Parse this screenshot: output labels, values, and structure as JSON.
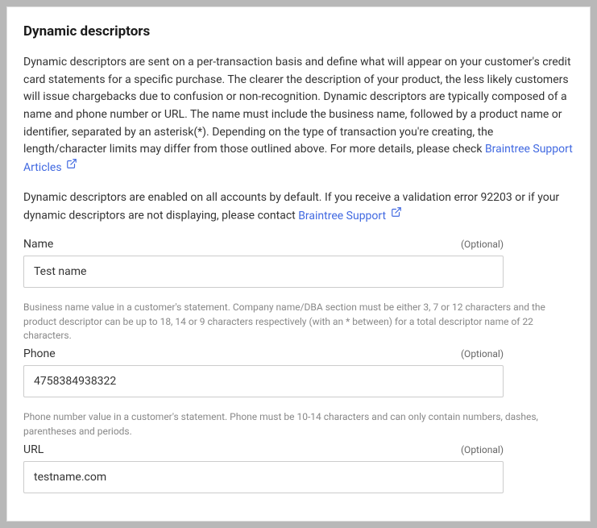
{
  "section": {
    "title": "Dynamic descriptors",
    "intro_text": "Dynamic descriptors are sent on a per-transaction basis and define what will appear on your customer's credit card statements for a specific purchase. The clearer the description of your product, the less likely customers will issue chargebacks due to confusion or non-recognition. Dynamic descriptors are typically composed of a name and phone number or URL. The name must include the business name, followed by a product name or identifier, separated by an asterisk(*). Depending on the type of transaction you're creating, the length/character limits may differ from those outlined above. For more details, please check ",
    "intro_link": "Braintree Support Articles",
    "para2_text": "Dynamic descriptors are enabled on all accounts by default. If you receive a validation error 92203 or if your dynamic descriptors are not displaying, please contact ",
    "para2_link": "Braintree Support"
  },
  "labels": {
    "optional": "(Optional)"
  },
  "fields": {
    "name": {
      "label": "Name",
      "value": "Test name",
      "hint": "Business name value in a customer's statement. Company name/DBA section must be either 3, 7 or 12 characters and the product descriptor can be up to 18, 14 or 9 characters respectively (with an * between) for a total descriptor name of 22 characters."
    },
    "phone": {
      "label": "Phone",
      "value": "4758384938322",
      "hint": "Phone number value in a customer's statement. Phone must be 10-14 characters and can only contain numbers, dashes, parentheses and periods."
    },
    "url": {
      "label": "URL",
      "value": "testname.com"
    }
  }
}
